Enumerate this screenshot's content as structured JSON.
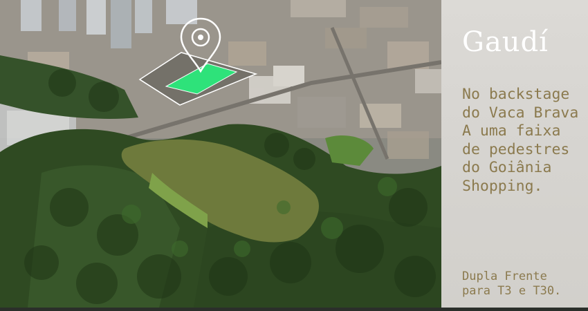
{
  "brand": {
    "name": "Gaudí"
  },
  "headline": {
    "lines": [
      "No backstage",
      "do Vaca Brava",
      "A uma faixa",
      "de pedestres",
      "do Goiânia",
      "Shopping."
    ]
  },
  "footer": {
    "lines": [
      "Dupla Frente",
      "para T3 e T30."
    ]
  },
  "colors": {
    "panel_bg": "#d8d6d2",
    "text_accent": "#8b7a4e",
    "plot_highlight": "#2ee27a",
    "lake": "#6e7a3c",
    "pin": "#ffffff"
  },
  "icons": {
    "location_pin": "map-pin-icon"
  }
}
